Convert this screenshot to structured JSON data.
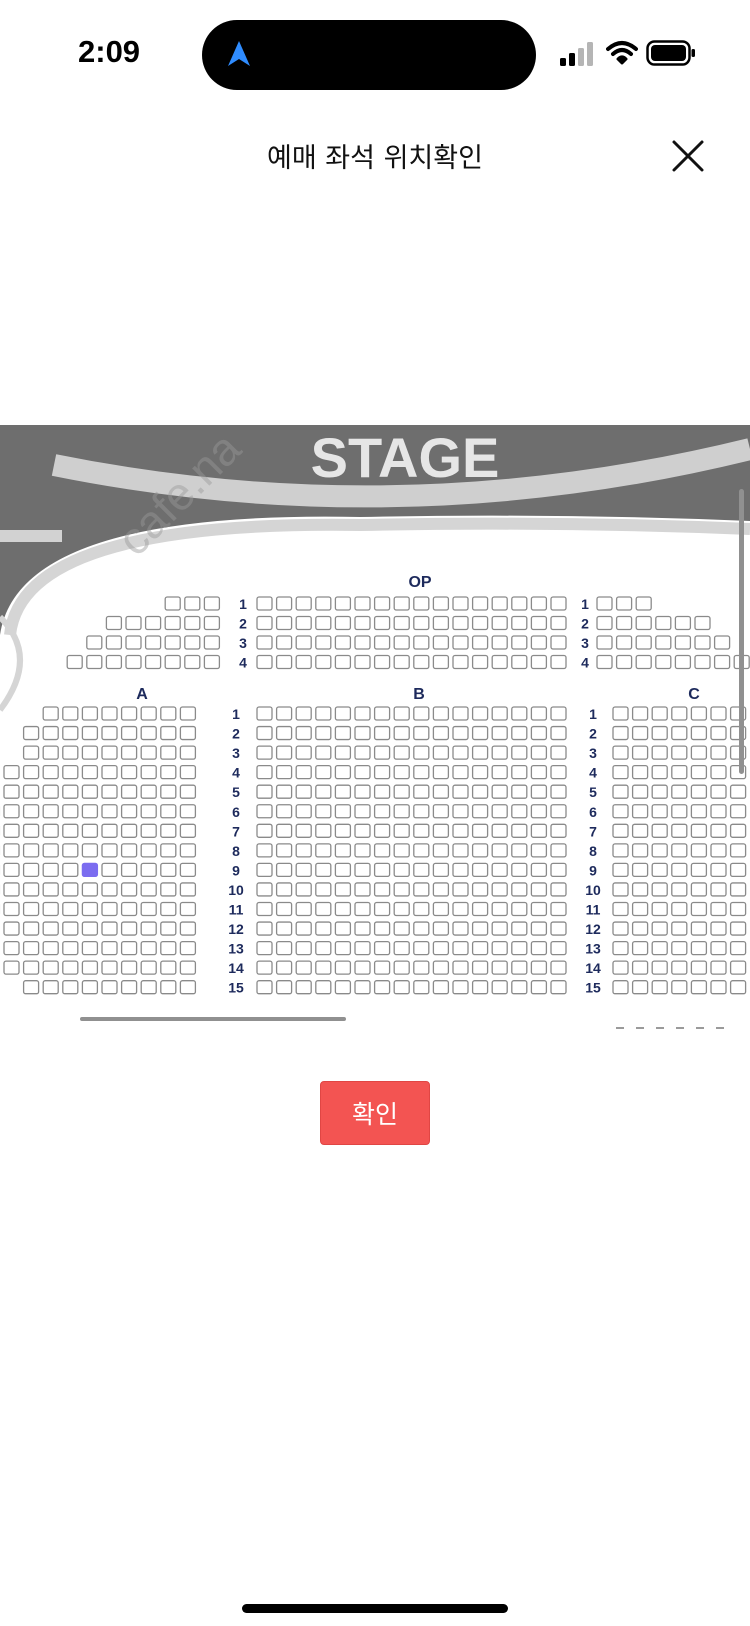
{
  "status": {
    "time": "2:09"
  },
  "header": {
    "title": "예매 좌석 위치확인"
  },
  "seatmap": {
    "stage_label": "STAGE",
    "watermark": "cafe.na",
    "op_label": "OP",
    "op_rows": [
      "1",
      "2",
      "3",
      "4"
    ],
    "section_labels": [
      "A",
      "B",
      "C"
    ],
    "rows": [
      "1",
      "2",
      "3",
      "4",
      "5",
      "6",
      "7",
      "8",
      "9",
      "10",
      "11",
      "12",
      "13",
      "14",
      "15"
    ],
    "highlight": {
      "section": "A",
      "row": "9",
      "color": "#7b6cf0"
    },
    "stage_color": "#6e6e6e",
    "seat_border_color": "#8a8a8a",
    "label_color": "#1d2a5c"
  },
  "footer": {
    "confirm_label": "확인",
    "confirm_color": "#f35452"
  }
}
